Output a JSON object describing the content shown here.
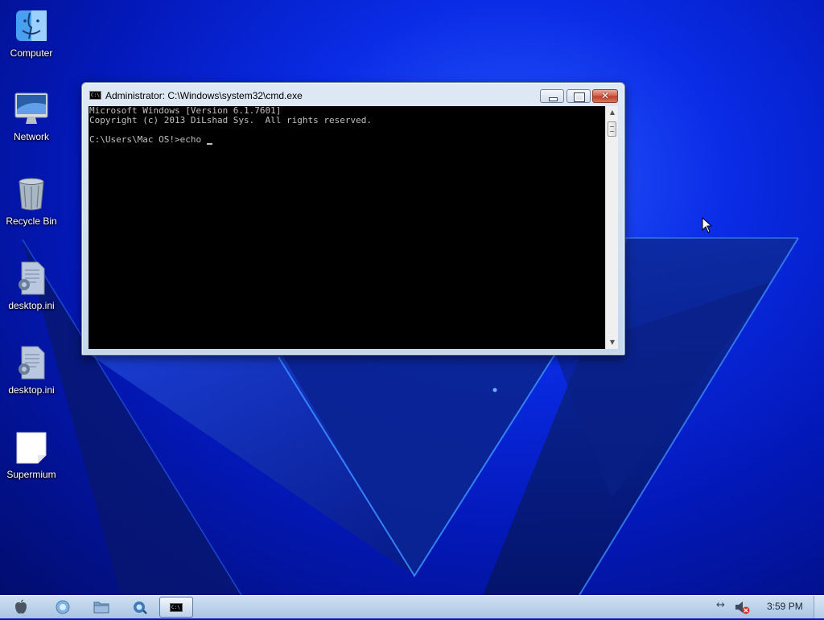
{
  "desktop": {
    "icons": [
      {
        "label": "Computer",
        "icon": "finder-icon"
      },
      {
        "label": "Network",
        "icon": "imac-monitor-icon"
      },
      {
        "label": "Recycle Bin",
        "icon": "recycle-bin-icon"
      },
      {
        "label": "desktop.ini",
        "icon": "settings-file-icon"
      },
      {
        "label": "desktop.ini",
        "icon": "settings-file-icon"
      },
      {
        "label": "Supermium",
        "icon": "blank-file-icon"
      }
    ]
  },
  "window": {
    "title": "Administrator: C:\\Windows\\system32\\cmd.exe",
    "title_icon_text": "C:\\",
    "close_glyph": "✕",
    "console_lines": [
      "Microsoft Windows [Version 6.1.7601]",
      "Copyright (c) 2013 DiLshad Sys.  All rights reserved.",
      "",
      "C:\\Users\\Mac OS!>echo "
    ]
  },
  "taskbar": {
    "items": [
      "apple-icon",
      "start-orb-icon",
      "folder-icon",
      "browser-icon",
      "cmd-icon"
    ],
    "cmd_glyph": "C:\\",
    "tray_network_glyph": "↔",
    "clock": "3:59 PM"
  },
  "colors": {
    "console_bg": "#000000",
    "console_text": "#c0c0c0",
    "desktop_blue": "#0a2ce6",
    "taskbar": "#b8d0ea"
  }
}
